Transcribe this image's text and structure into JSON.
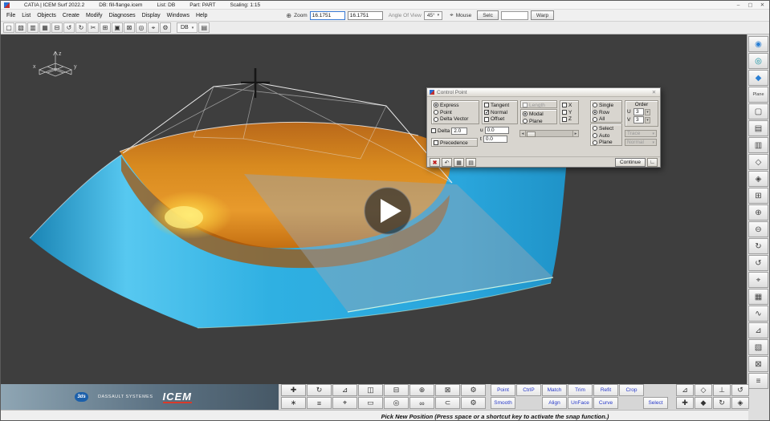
{
  "titlebar": {
    "title": "CATIA | ICEM Surf 2022.2",
    "db": "DB: fill-flange.icem",
    "list": "List: DB",
    "part": "Part: PART",
    "scaling": "Scaling: 1:15",
    "minimize": "–",
    "maximize": "▢",
    "close": "✕"
  },
  "menubar": {
    "items": [
      "File",
      "List",
      "Objects",
      "Create",
      "Modify",
      "Diagnoses",
      "Display",
      "Windows",
      "Help"
    ]
  },
  "viewbar": {
    "zoom_icon": "⊕",
    "zoom_label": "Zoom",
    "zoom_x": "16.1751",
    "zoom_y": "16.1751",
    "angle_label": "Angle Of View",
    "angle_value": "45°",
    "angle_arrow": "▾",
    "mouse_icon": "⌖",
    "mouse_label": "Mouse",
    "selc": "Selc",
    "warp": "Warp"
  },
  "iconbar": {
    "icons": [
      {
        "name": "new-file-icon",
        "glyph": "▢"
      },
      {
        "name": "open-file-icon",
        "glyph": "▧"
      },
      {
        "name": "save-icon",
        "glyph": "▥"
      },
      {
        "name": "save-all-icon",
        "glyph": "▦"
      },
      {
        "name": "print-icon",
        "glyph": "⊟"
      },
      {
        "name": "undo-icon",
        "glyph": "↺"
      },
      {
        "name": "redo-icon",
        "glyph": "↻"
      },
      {
        "name": "cut-icon",
        "glyph": "✂"
      },
      {
        "name": "copy-icon",
        "glyph": "⊞"
      },
      {
        "name": "paste-icon",
        "glyph": "▣"
      },
      {
        "name": "delete-icon",
        "glyph": "⊠"
      },
      {
        "name": "refresh-icon",
        "glyph": "◎"
      },
      {
        "name": "measure-icon",
        "glyph": "⌖"
      },
      {
        "name": "settings-icon",
        "glyph": "⚙"
      }
    ],
    "db": "DB",
    "db_arrow": "▾",
    "extra_icon": "▤"
  },
  "dialog": {
    "title": "Control Point",
    "close": "✕",
    "express": "Express",
    "point": "Point",
    "delta_vector": "Delta Vector",
    "tangent": "Tangent",
    "normal": "Normal",
    "offset": "Offset",
    "length": "Length",
    "modal": "Modal",
    "plane": "Plane",
    "x": "X",
    "y": "Y",
    "z": "Z",
    "single": "Single",
    "row": "Row",
    "all": "All",
    "select": "Select",
    "auto": "Auto",
    "plane2": "Plane",
    "order_label": "Order",
    "u_label": "U",
    "u_value": "3",
    "v_label": "V",
    "v_value": "3",
    "spin_arrow": "▾",
    "delta_label": "Delta",
    "delta_value": "2.0",
    "u_small": "u",
    "u_field": "0.0",
    "t_small": "t",
    "t_field": "0.0",
    "slider_left": "◂",
    "slider_right": "▸",
    "precedence": "Precedence",
    "trace": "Trace",
    "trace_arrow": "▾",
    "normal_dd": "Normal",
    "normal_dd_arrow": "▾",
    "cancel_icon": "✖",
    "undo_icon": "↶",
    "grid_icon": "▦",
    "table_icon": "▤",
    "continue_label": "Continue",
    "corner_icon": "∟"
  },
  "sidebar": {
    "icons": [
      {
        "name": "orbit-view-icon",
        "glyph": "◉"
      },
      {
        "name": "sphere-view-icon",
        "glyph": "◎"
      },
      {
        "name": "shaded-view-icon",
        "glyph": "◆"
      },
      {
        "name": "plane-view-button",
        "glyph": "Plane"
      },
      {
        "name": "top-view-icon",
        "glyph": "▢"
      },
      {
        "name": "front-view-icon",
        "glyph": "▤"
      },
      {
        "name": "right-view-icon",
        "glyph": "▥"
      },
      {
        "name": "iso-view-icon",
        "glyph": "◇"
      },
      {
        "name": "perspective-view-icon",
        "glyph": "◈"
      },
      {
        "name": "zoom-window-icon",
        "glyph": "⊞"
      },
      {
        "name": "zoom-in-icon",
        "glyph": "⊕"
      },
      {
        "name": "zoom-out-icon",
        "glyph": "⊖"
      },
      {
        "name": "rotate-cw-icon",
        "glyph": "↻"
      },
      {
        "name": "rotate-ccw-icon",
        "glyph": "↺"
      },
      {
        "name": "center-view-icon",
        "glyph": "⌖"
      },
      {
        "name": "grid-display-icon",
        "glyph": "▦"
      },
      {
        "name": "curve-display-icon",
        "glyph": "∿"
      },
      {
        "name": "mesh-display-icon",
        "glyph": "⊿"
      },
      {
        "name": "hatch-display-icon",
        "glyph": "▧"
      },
      {
        "name": "clip-plane-icon",
        "glyph": "⊠"
      },
      {
        "name": "layer-list-icon",
        "glyph": "≡"
      }
    ]
  },
  "scene": {
    "axis_x": "x",
    "axis_y": "y",
    "axis_z": "z",
    "colors": {
      "surface_blue": "#2fb3e8",
      "surface_orange": "#dd8020",
      "highlight_yellow": "#ffdf4a",
      "background": "#3e3e3e"
    }
  },
  "bottombar": {
    "tools_row1": [
      {
        "name": "move-tool-icon",
        "glyph": "✚"
      },
      {
        "name": "rotate-tool-icon",
        "glyph": "↻"
      },
      {
        "name": "scale-tool-icon",
        "glyph": "⊿"
      },
      {
        "name": "mirror-tool-icon",
        "glyph": "◫"
      },
      {
        "name": "offset-tool-icon",
        "glyph": "⊟"
      },
      {
        "name": "project-tool-icon",
        "glyph": "⊕"
      },
      {
        "name": "intersect-tool-icon",
        "glyph": "⊠"
      },
      {
        "name": "options-tool-icon",
        "glyph": "⚙"
      }
    ],
    "tools_row2": [
      {
        "name": "freeform-tool-icon",
        "glyph": "∗"
      },
      {
        "name": "align-tool-icon",
        "glyph": "≡"
      },
      {
        "name": "snap-tool-icon",
        "glyph": "⌖"
      },
      {
        "name": "flatten-tool-icon",
        "glyph": "▭"
      },
      {
        "name": "blend-tool-icon",
        "glyph": "◎"
      },
      {
        "name": "twist-tool-icon",
        "glyph": "∞"
      },
      {
        "name": "link-tool-icon",
        "glyph": "⊂"
      },
      {
        "name": "options2-tool-icon",
        "glyph": "⚙"
      }
    ],
    "buttons_row1": [
      "Point",
      "CtrlP",
      "Match",
      "Trim",
      "Refit",
      "Crop"
    ],
    "buttons_row2": [
      "Smooth",
      "Align",
      "UnFace",
      "Curve"
    ],
    "select": "Select",
    "right_tools_row1": [
      {
        "name": "axis-x-icon",
        "glyph": "⊿"
      },
      {
        "name": "axis-y-icon",
        "glyph": "◇"
      },
      {
        "name": "axis-z-icon",
        "glyph": "⊥"
      },
      {
        "name": "orbit-snap-icon",
        "glyph": "↺"
      }
    ],
    "right_tools_row2": [
      {
        "name": "snap-x-icon",
        "glyph": "✚"
      },
      {
        "name": "snap-y-icon",
        "glyph": "◆"
      },
      {
        "name": "snap-z-icon",
        "glyph": "↻"
      },
      {
        "name": "view-cube-icon",
        "glyph": "◈"
      }
    ]
  },
  "branding": {
    "logo": "3ds",
    "company": "DASSAULT SYSTEMES",
    "product": "ICEM"
  },
  "statusbar": {
    "hint": "Pick New Position (Press space or a shortcut key to activate the snap function.)"
  }
}
